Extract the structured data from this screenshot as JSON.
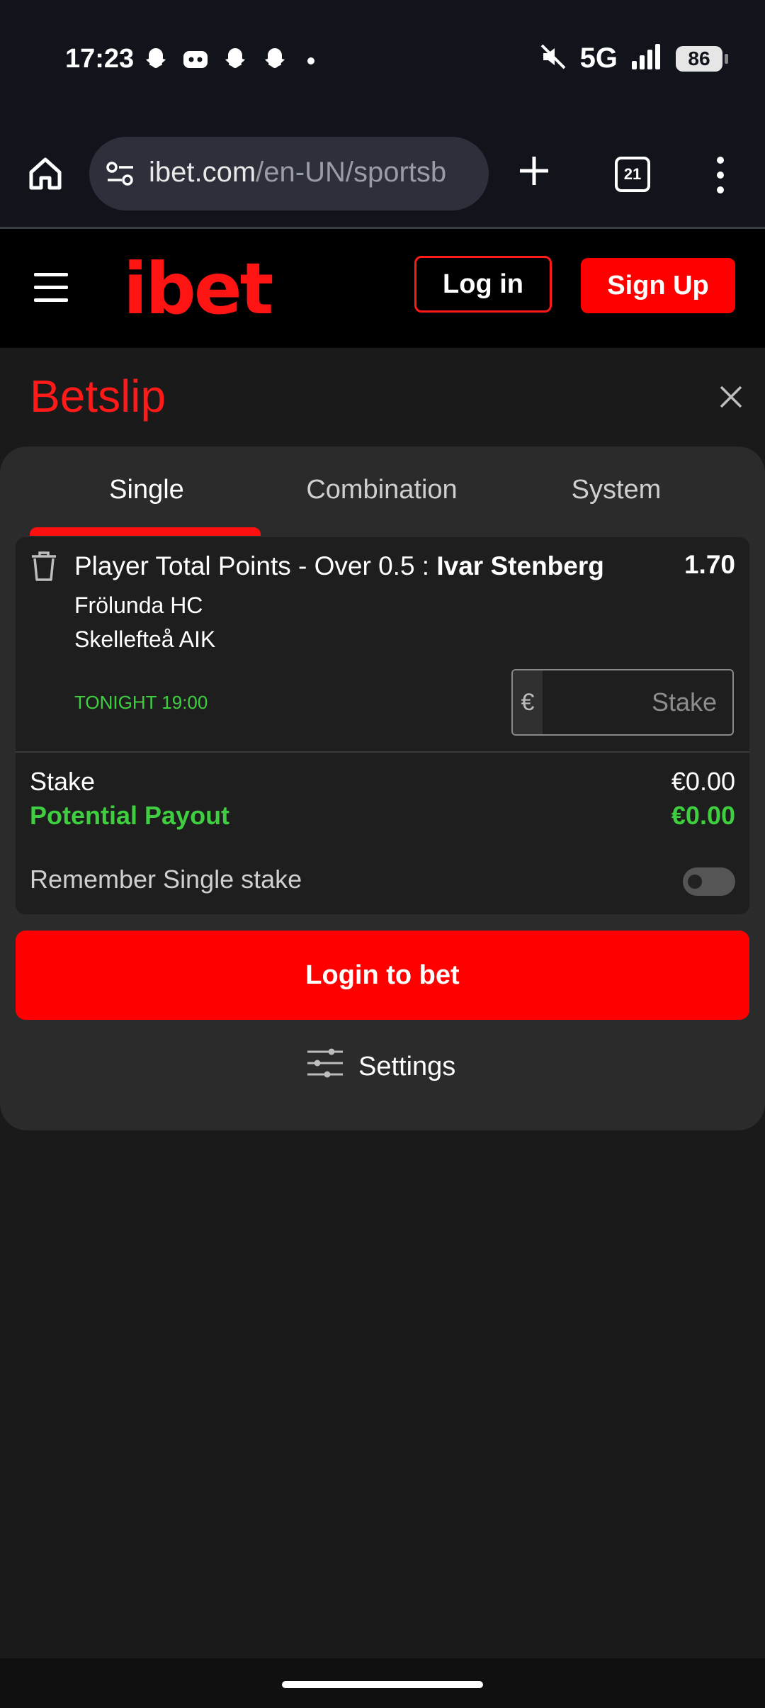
{
  "status_bar": {
    "time": "17:23",
    "network": "5G",
    "battery": "86",
    "icons": [
      "snapchat-icon",
      "discord-icon",
      "snapchat-icon",
      "snapchat-icon",
      "dot-icon",
      "mute-icon",
      "signal-icon",
      "battery-icon"
    ]
  },
  "browser": {
    "url_domain": "ibet.com",
    "url_path": "/en-UN/sportsb",
    "tab_count": "21"
  },
  "header": {
    "logo": "ibet",
    "login_label": "Log in",
    "signup_label": "Sign Up"
  },
  "betslip": {
    "title": "Betslip",
    "tabs": [
      {
        "label": "Single",
        "active": true
      },
      {
        "label": "Combination",
        "active": false
      },
      {
        "label": "System",
        "active": false
      }
    ],
    "selection": {
      "market": "Player Total Points - Over 0.5 : ",
      "player": "Ivar Stenberg",
      "odds": "1.70",
      "team_home": "Frölunda HC",
      "team_away": "Skellefteå AIK",
      "start_time": "TONIGHT 19:00",
      "currency": "€",
      "stake_placeholder": "Stake"
    },
    "summary": {
      "stake_label": "Stake",
      "stake_value": "€0.00",
      "payout_label": "Potential Payout",
      "payout_value": "€0.00"
    },
    "remember_label": "Remember Single stake",
    "remember_on": false,
    "login_button": "Login to bet",
    "settings_label": "Settings"
  },
  "colors": {
    "brand_red": "#ff0000",
    "success_green": "#3fce3f",
    "background": "#1a1a1a",
    "panel": "#2b2b2b"
  }
}
